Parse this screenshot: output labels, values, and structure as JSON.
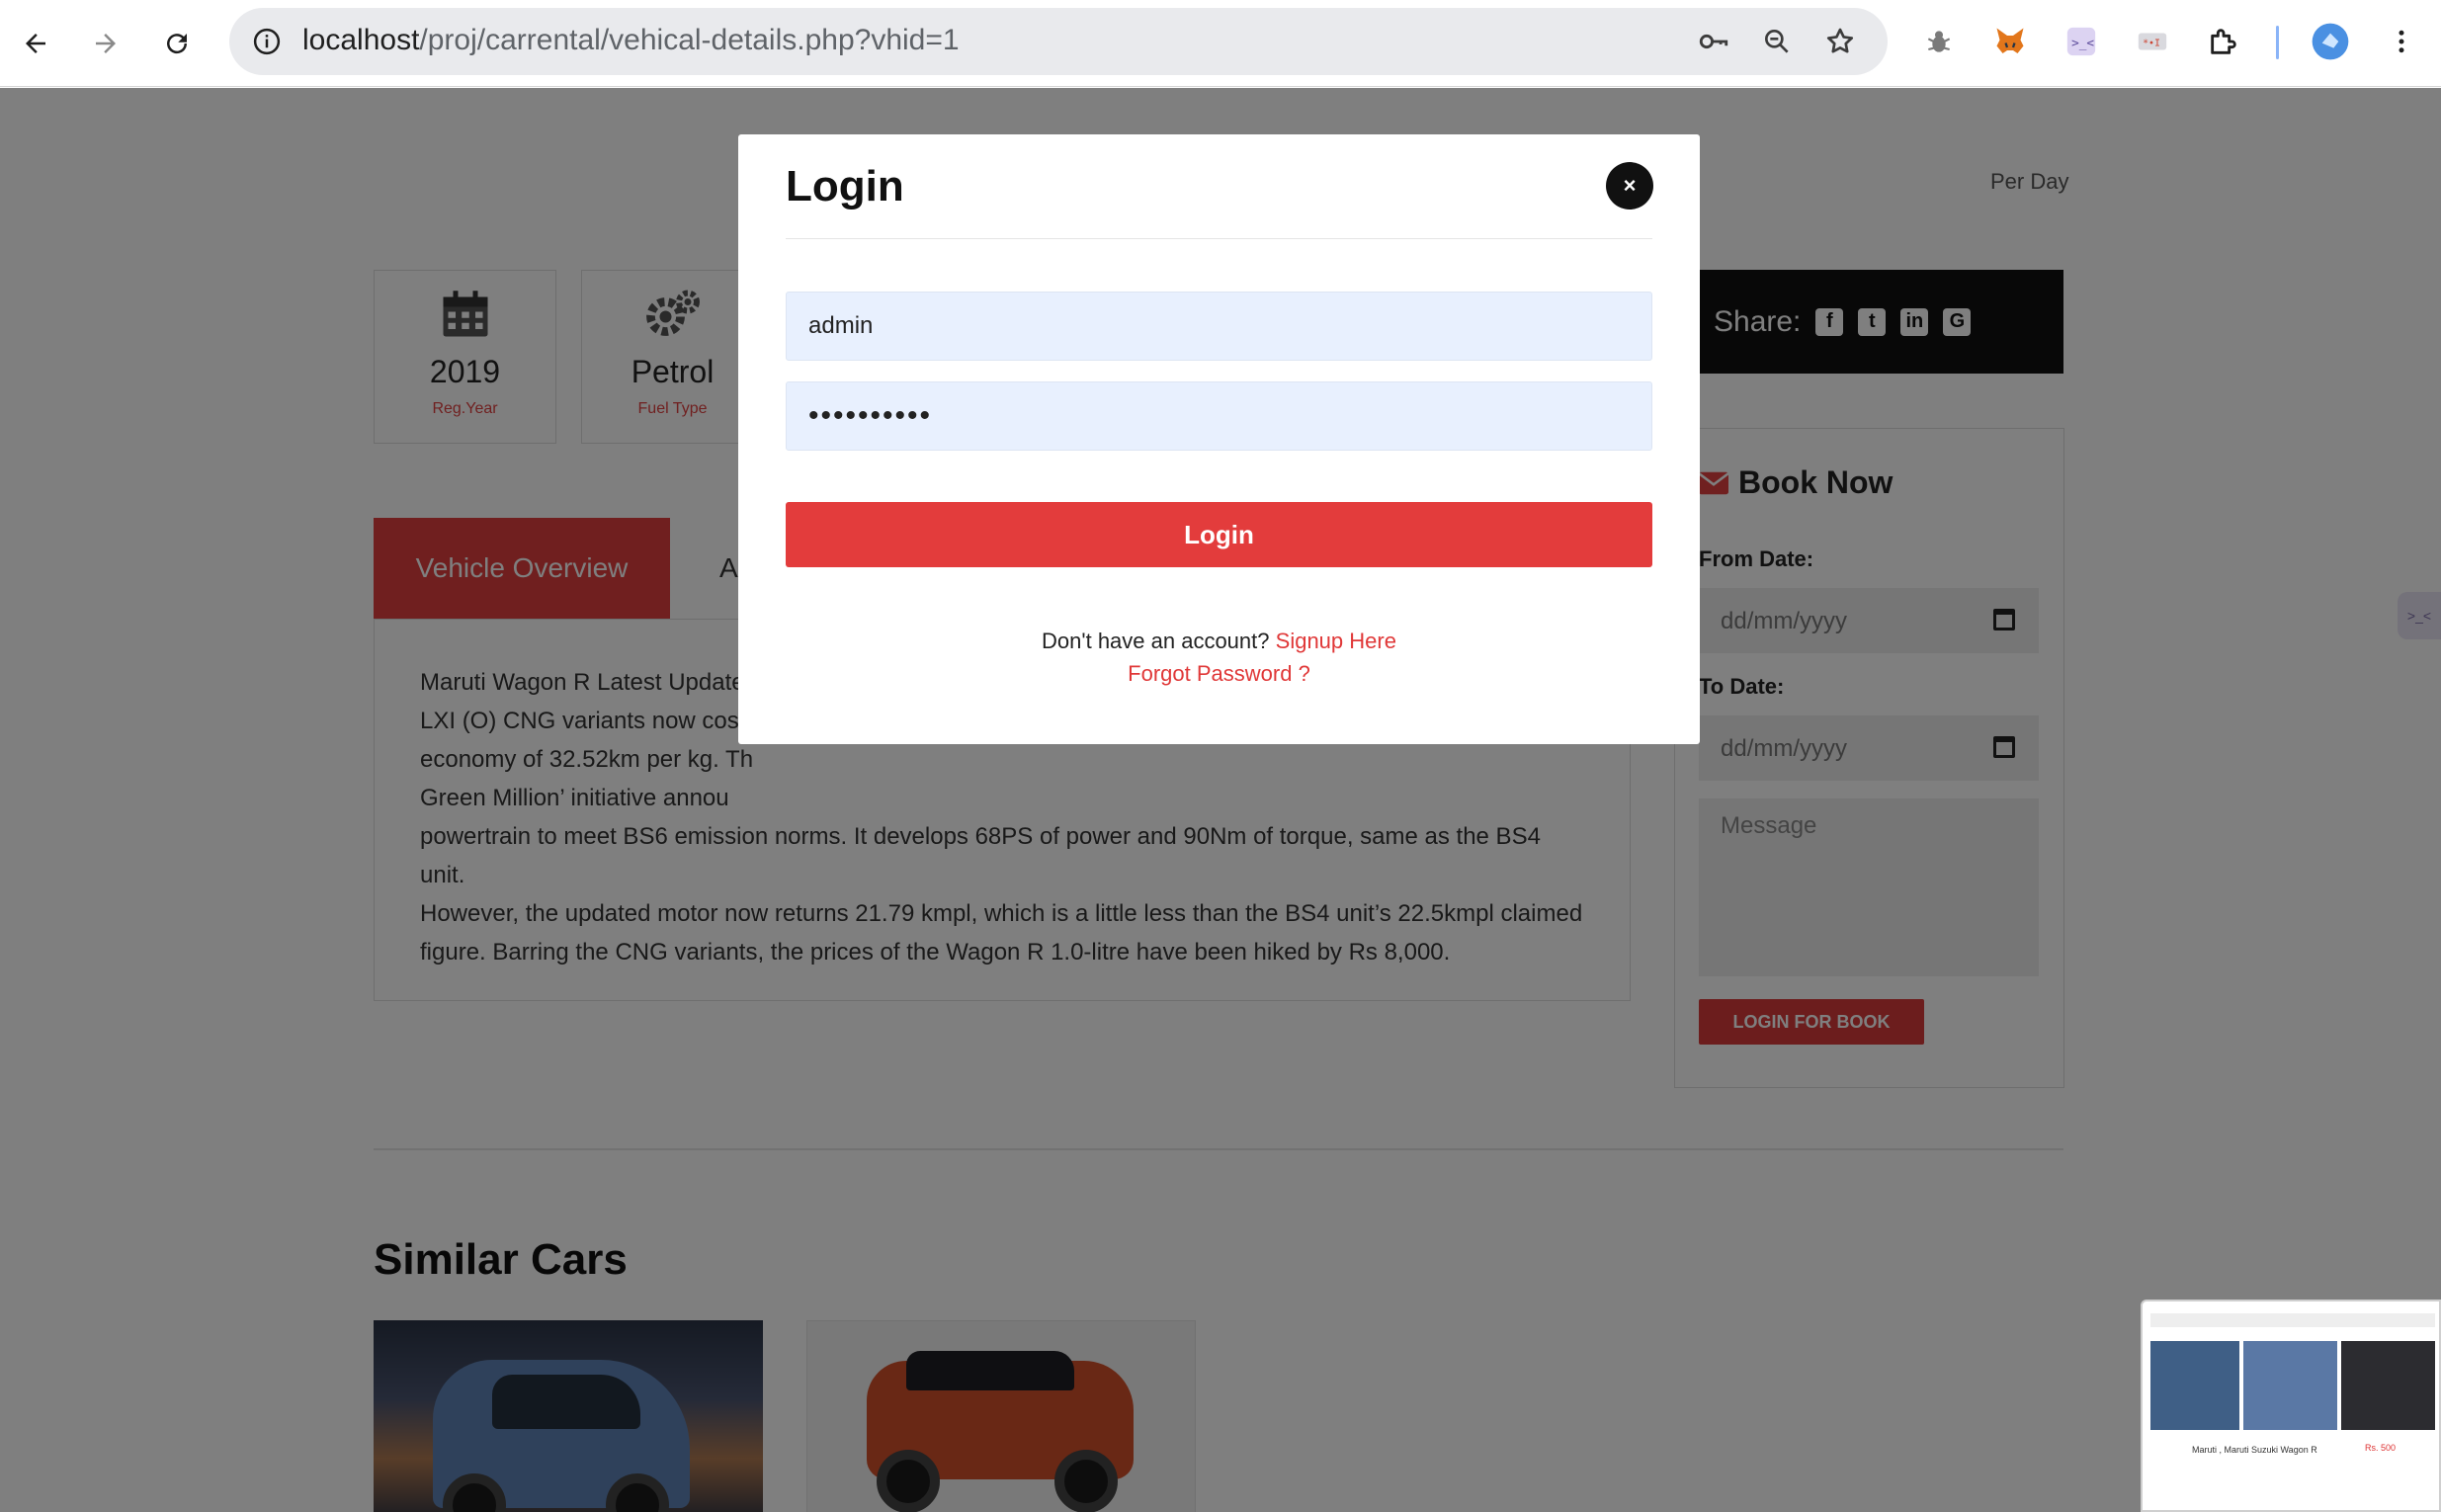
{
  "browser": {
    "url_host": "localhost",
    "url_path": "/proj/carrental/vehical-details.php?vhid=1"
  },
  "page": {
    "per_day": "Per Day",
    "stats": [
      {
        "value": "2019",
        "label": "Reg.Year",
        "icon": "calendar-icon"
      },
      {
        "value": "Petrol",
        "label": "Fuel Type",
        "icon": "gears-icon"
      }
    ],
    "tabs": {
      "active": "Vehicle Overview",
      "second": "A"
    },
    "overview_lines": [
      "Maruti Wagon R Latest Update",
      "LXI (O) CNG variants now cost",
      "economy of 32.52km per kg. Th",
      "Green Million’ initiative annou",
      "powertrain to meet BS6 emission norms. It develops 68PS of power and 90Nm of torque, same as the BS4 unit.",
      "However, the updated motor now returns 21.79 kmpl, which is a little less than the BS4 unit’s 22.5kmpl claimed",
      "figure. Barring the CNG variants, the prices of the Wagon R 1.0-litre have been hiked by Rs 8,000."
    ],
    "share": {
      "label": "Share:",
      "icons": [
        "facebook-icon",
        "twitter-icon",
        "linkedin-icon",
        "google-plus-icon"
      ]
    },
    "booking": {
      "title": "Book Now",
      "from_label": "From Date:",
      "from_placeholder": "dd/mm/yyyy",
      "to_label": "To Date:",
      "to_placeholder": "dd/mm/yyyy",
      "message_placeholder": "Message",
      "button": "LOGIN FOR BOOK"
    },
    "similar_title": "Similar Cars",
    "thumbnail": {
      "caption": "Maruti , Maruti Suzuki Wagon R",
      "price": "Rs. 500"
    }
  },
  "modal": {
    "title": "Login",
    "close_label": "×",
    "username_value": "admin",
    "password_value": "••••••••••",
    "login_button": "Login",
    "no_account_text": "Don't have an account?",
    "signup_link": "Signup Here",
    "forgot_link": "Forgot Password ?"
  },
  "colors": {
    "accent": "#e33c3c",
    "share_bar": "#111111",
    "autofill": "#e8f0fe"
  }
}
